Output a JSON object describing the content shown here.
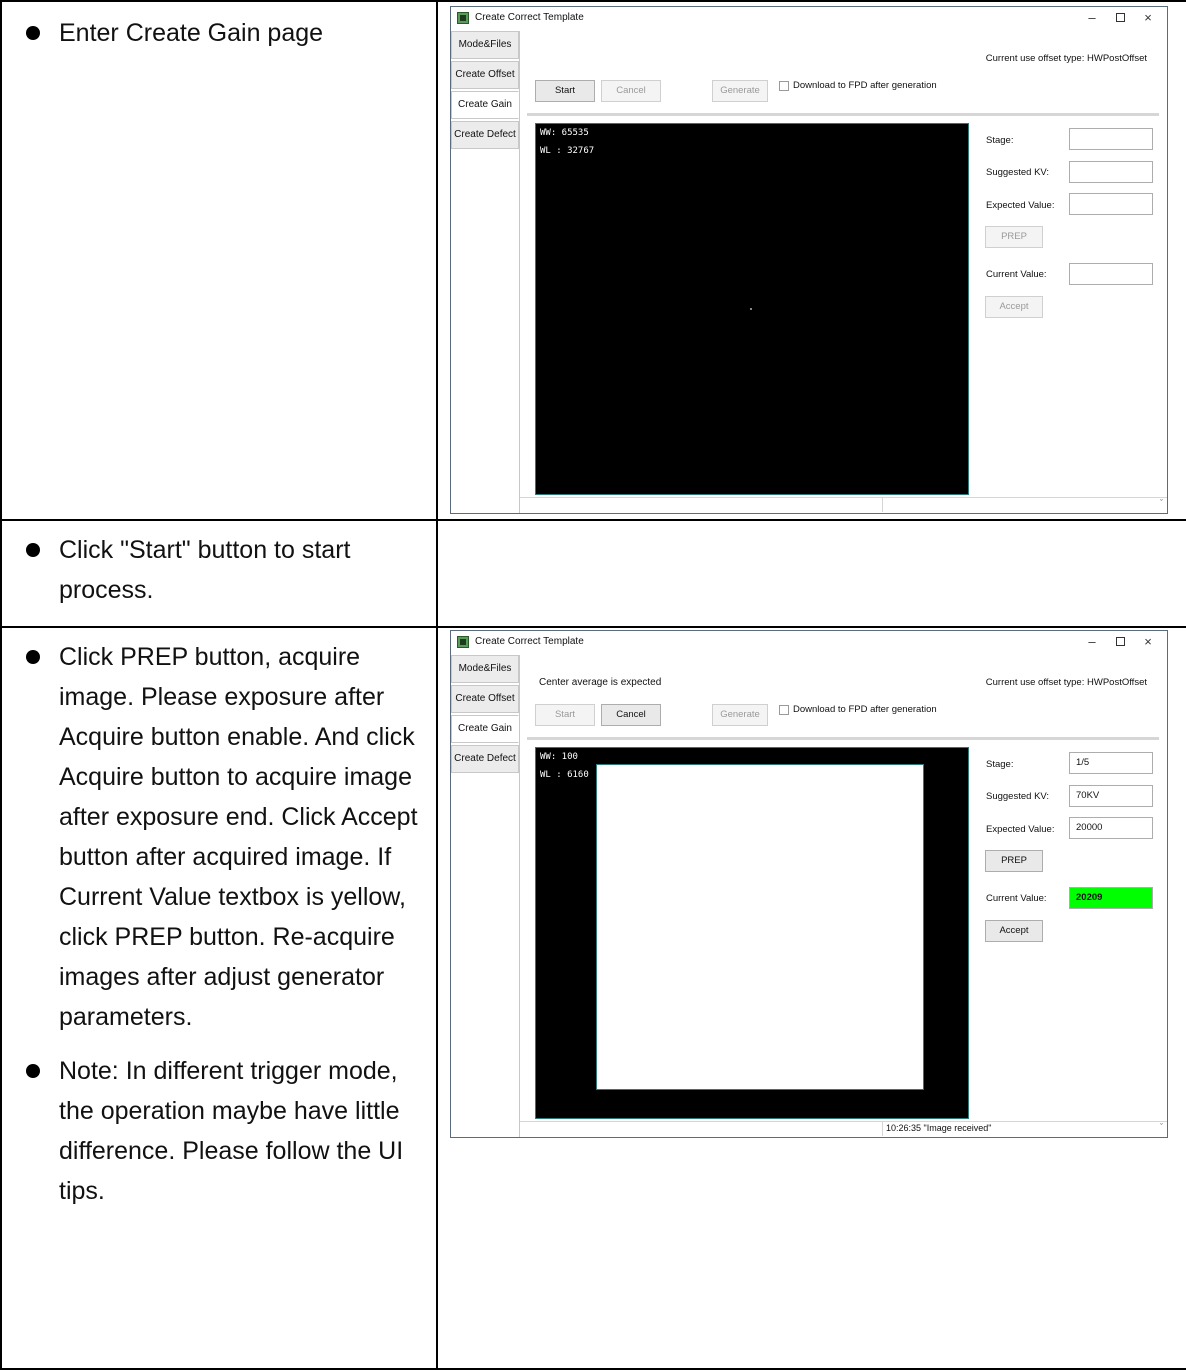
{
  "rows": [
    {
      "instructions": [
        "Enter Create Gain page"
      ]
    },
    {
      "instructions": [
        "Click \"Start\" button to start process."
      ]
    },
    {
      "instructions": [
        "Click PREP button, acquire image. Please exposure after Acquire button enable. And click Acquire button to acquire image after exposure end. Click Accept button after acquired image. If Current Value textbox is yellow, click PREP button. Re-acquire images after adjust generator parameters.",
        "Note: In different trigger mode, the operation maybe have little difference. Please follow the UI tips."
      ]
    }
  ],
  "window": {
    "title": "Create Correct Template",
    "controls": {
      "minimize": "–",
      "close": "×"
    },
    "side_tabs": [
      "Mode&Files",
      "Create Offset",
      "Create Gain",
      "Create Defect"
    ],
    "offset_type_label": "Current use offset type: HWPostOffset",
    "buttons": {
      "start": "Start",
      "cancel": "Cancel",
      "generate": "Generate",
      "prep": "PREP",
      "accept": "Accept"
    },
    "download_checkbox_label": "Download to FPD after generation",
    "field_labels": {
      "stage": "Stage:",
      "suggested_kv": "Suggested KV:",
      "expected_value": "Expected Value:",
      "current_value": "Current Value:"
    },
    "scroll_chevron": "ˇ"
  },
  "screenshot1": {
    "ww": "WW:  65535",
    "wl": "WL :  32767",
    "stage": "",
    "suggested_kv": "",
    "expected_value": "",
    "current_value": "",
    "status": ""
  },
  "screenshot2": {
    "hint": "Center average is expected",
    "ww": "WW:  100",
    "wl": "WL :  6160",
    "stage": "1/5",
    "suggested_kv": "70KV",
    "expected_value": "20000",
    "current_value": "20209",
    "status": "10:26:35 \"Image received\""
  },
  "colors": {
    "current_value_ok": "#00ff00",
    "viewer_border": "#2d7a7a"
  }
}
